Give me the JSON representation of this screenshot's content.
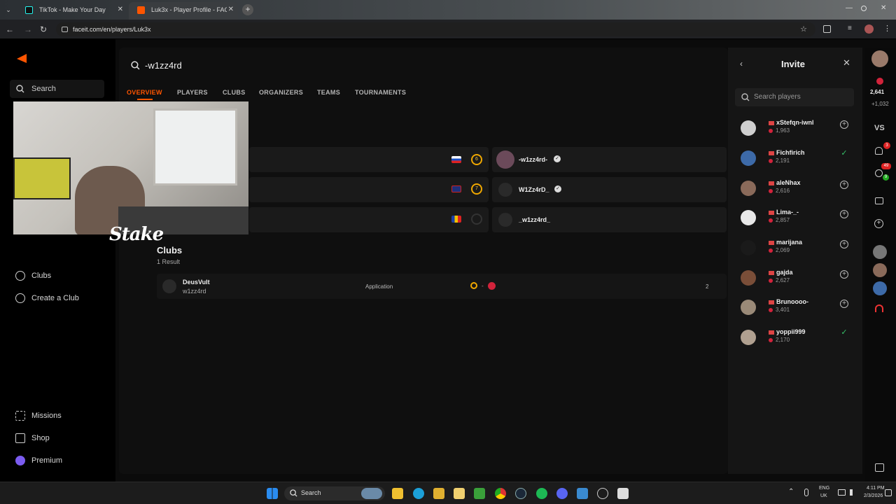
{
  "browser": {
    "tabs": [
      {
        "title": "TikTok - Make Your Day"
      },
      {
        "title": "Luk3x - Player Profile - FACEIT.c"
      }
    ],
    "url": "faceit.com/en/players/Luk3x"
  },
  "sidebar": {
    "search_label": "Search",
    "items": [
      {
        "label": "Clubs"
      },
      {
        "label": "Create a Club"
      },
      {
        "label": "Missions"
      },
      {
        "label": "Shop"
      },
      {
        "label": "Premium"
      }
    ]
  },
  "search": {
    "query": "-w1zz4rd",
    "tabs": [
      "OVERVIEW",
      "PLAYERS",
      "CLUBS",
      "ORGANIZERS",
      "TEAMS",
      "TOURNAMENTS"
    ],
    "active_tab": "OVERVIEW"
  },
  "player_results": [
    {
      "name": "-w1zz4rd-",
      "level": "6",
      "verified": true
    },
    {
      "name": "W1Zz4rD_",
      "level": "7",
      "verified": true
    },
    {
      "name": "_w1zz4rd_",
      "level": "",
      "verified": false
    }
  ],
  "clubs_section": {
    "title": "Clubs",
    "count": "1 Result",
    "rows": [
      {
        "name": "DeusVult",
        "sub": "w1zz4rd",
        "join_type": "Application",
        "range": "-",
        "members": "2"
      }
    ]
  },
  "webcam": {
    "overlay_text": "Stake"
  },
  "invite": {
    "title": "Invite",
    "search_placeholder": "Search players",
    "players": [
      {
        "name": "xStefqn-iwnl",
        "elo": "1,963",
        "action": "add"
      },
      {
        "name": "Fichfirich",
        "elo": "2,191",
        "action": "invited"
      },
      {
        "name": "aleNhax",
        "elo": "2,616",
        "action": "add"
      },
      {
        "name": "Lima-_-",
        "elo": "2,857",
        "action": "add"
      },
      {
        "name": "marijana",
        "elo": "2,069",
        "action": "add"
      },
      {
        "name": "gajda",
        "elo": "2,627",
        "action": "add"
      },
      {
        "name": "Brunoooo-",
        "elo": "3,401",
        "action": "add"
      },
      {
        "name": "yoppii999",
        "elo": "2,170",
        "action": "invited"
      }
    ]
  },
  "right_strip": {
    "elo": "2,641",
    "elo_change": "+1,032",
    "vs_label": "VS",
    "notif_count": "3",
    "friends_count": "49",
    "friends_online": "9"
  },
  "taskbar": {
    "search_label": "Search",
    "lang_line1": "ENG",
    "lang_line2": "UK",
    "time": "4:11 PM",
    "date": "2/3/2026"
  },
  "colors": {
    "accent": "#ff5500",
    "invited_check": "#36c36a",
    "elo_dot": "#d2233b"
  }
}
